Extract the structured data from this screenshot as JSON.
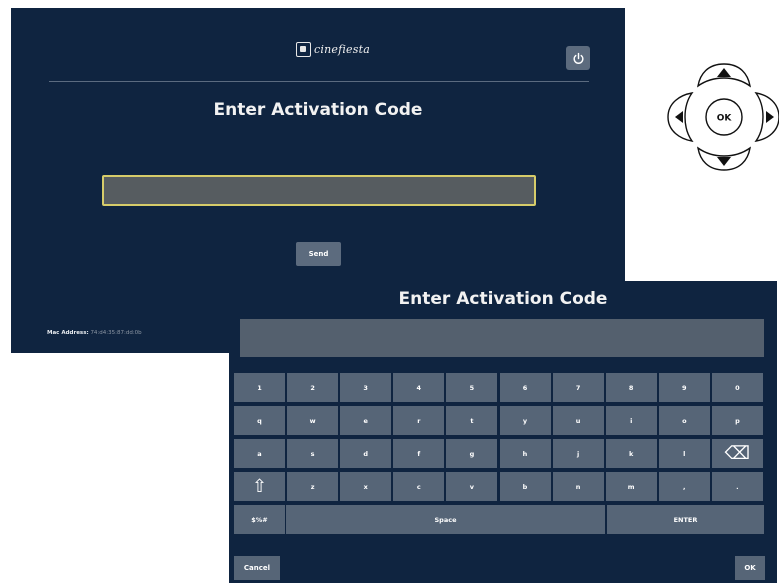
{
  "back_screen": {
    "logo_text": "cinefiesta",
    "power_icon": "power-icon",
    "title": "Enter Activation Code",
    "code_input_value": "",
    "send_label": "Send",
    "mac_label": "Mac Address:",
    "mac_value": "74:d4:35:87:dd:0b"
  },
  "keyboard_screen": {
    "title": "Enter Activation Code",
    "input_value": "",
    "rows": [
      [
        "1",
        "2",
        "3",
        "4",
        "5",
        "6",
        "7",
        "8",
        "9",
        "0"
      ],
      [
        "q",
        "w",
        "e",
        "r",
        "t",
        "y",
        "u",
        "i",
        "o",
        "p"
      ],
      [
        "a",
        "s",
        "d",
        "f",
        "g",
        "h",
        "j",
        "k",
        "l",
        "⌫"
      ],
      [
        "⇧",
        "z",
        "x",
        "c",
        "v",
        "b",
        "n",
        "m",
        ",",
        "."
      ]
    ],
    "symbols_label": "$%#",
    "space_label": "Space",
    "enter_label": "ENTER",
    "cancel_label": "Cancel",
    "ok_label": "OK"
  },
  "remote": {
    "ok_label": "OK",
    "up_icon": "arrow-up-icon",
    "down_icon": "arrow-down-icon",
    "left_icon": "arrow-left-icon",
    "right_icon": "arrow-right-icon"
  },
  "colors": {
    "screen_bg": "#0f2440",
    "key_bg": "#566577",
    "input_highlight": "#d6cc6a"
  }
}
